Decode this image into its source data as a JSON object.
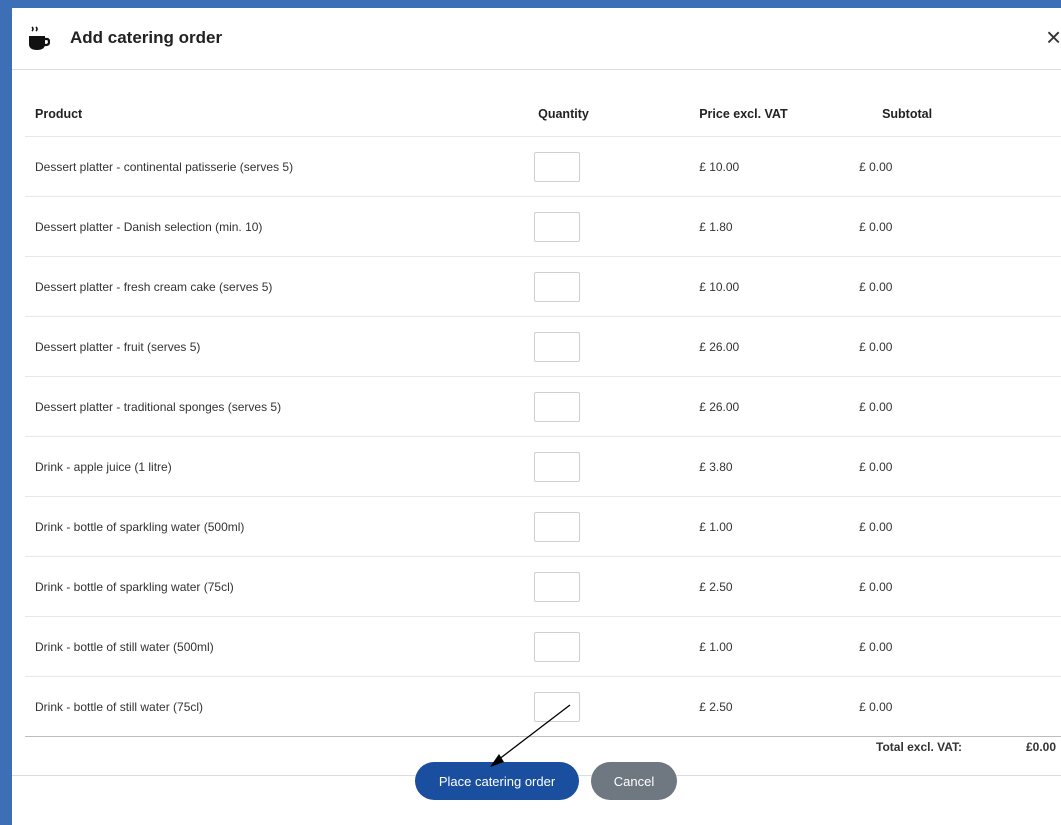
{
  "dialog": {
    "title": "Add catering order",
    "header_icon": "coffee-cup-icon",
    "close_icon": "close-icon",
    "close_glyph": "×"
  },
  "table": {
    "headers": {
      "product": "Product",
      "quantity": "Quantity",
      "price": "Price excl. VAT",
      "subtotal": "Subtotal"
    },
    "rows": [
      {
        "product": "Dessert platter - continental patisserie (serves 5)",
        "quantity": "",
        "price": "£ 10.00",
        "subtotal": "£ 0.00"
      },
      {
        "product": "Dessert platter - Danish selection (min. 10)",
        "quantity": "",
        "price": "£ 1.80",
        "subtotal": "£ 0.00"
      },
      {
        "product": "Dessert platter - fresh cream cake (serves 5)",
        "quantity": "",
        "price": "£ 10.00",
        "subtotal": "£ 0.00"
      },
      {
        "product": "Dessert platter - fruit (serves 5)",
        "quantity": "",
        "price": "£ 26.00",
        "subtotal": "£ 0.00"
      },
      {
        "product": "Dessert platter - traditional sponges (serves 5)",
        "quantity": "",
        "price": "£ 26.00",
        "subtotal": "£ 0.00"
      },
      {
        "product": "Drink - apple juice (1 litre)",
        "quantity": "",
        "price": "£ 3.80",
        "subtotal": "£ 0.00"
      },
      {
        "product": "Drink - bottle of sparkling water (500ml)",
        "quantity": "",
        "price": "£ 1.00",
        "subtotal": "£ 0.00"
      },
      {
        "product": "Drink - bottle of sparkling water (75cl)",
        "quantity": "",
        "price": "£ 2.50",
        "subtotal": "£ 0.00"
      },
      {
        "product": "Drink - bottle of still water (500ml)",
        "quantity": "",
        "price": "£ 1.00",
        "subtotal": "£ 0.00"
      },
      {
        "product": "Drink - bottle of still water (75cl)",
        "quantity": "",
        "price": "£ 2.50",
        "subtotal": "£ 0.00"
      }
    ]
  },
  "totals": {
    "label": "Total excl. VAT:",
    "value": "£0.00"
  },
  "buttons": {
    "place_order": "Place catering order",
    "cancel": "Cancel"
  },
  "colors": {
    "window_border": "#3d6fb6",
    "primary_button": "#1a4fa0",
    "cancel_button": "#6f7780"
  }
}
